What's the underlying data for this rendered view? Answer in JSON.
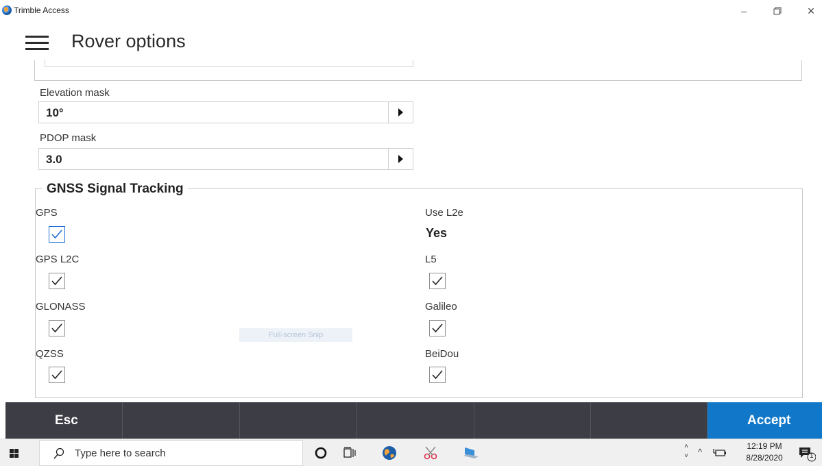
{
  "window": {
    "title": "Trimble Access",
    "minimize": "–",
    "restore": "▭",
    "close": "×"
  },
  "header": {
    "title": "Rover options"
  },
  "fields": {
    "elevation_mask": {
      "label": "Elevation mask",
      "value": "10°"
    },
    "pdop_mask": {
      "label": "PDOP mask",
      "value": "3.0"
    }
  },
  "gnss": {
    "title": "GNSS Signal Tracking",
    "gps": {
      "label": "GPS",
      "checked": true
    },
    "gps_l2c": {
      "label": "GPS L2C",
      "checked": true
    },
    "glonass": {
      "label": "GLONASS",
      "checked": true
    },
    "qzss": {
      "label": "QZSS",
      "checked": true
    },
    "use_l2e": {
      "label": "Use L2e",
      "value": "Yes"
    },
    "l5": {
      "label": "L5",
      "checked": true
    },
    "galileo": {
      "label": "Galileo",
      "checked": true
    },
    "beidou": {
      "label": "BeiDou",
      "checked": true
    }
  },
  "overlay": {
    "snip": "Full-screen Snip"
  },
  "softkeys": {
    "esc": "Esc",
    "accept": "Accept"
  },
  "taskbar": {
    "search_placeholder": "Type here to search",
    "time": "12:19 PM",
    "date": "8/28/2020",
    "notification_count": "1"
  },
  "colors": {
    "accent": "#1178c9",
    "softkey_bar": "#3d3d45",
    "checkbox_focus": "#1f6fd8"
  }
}
